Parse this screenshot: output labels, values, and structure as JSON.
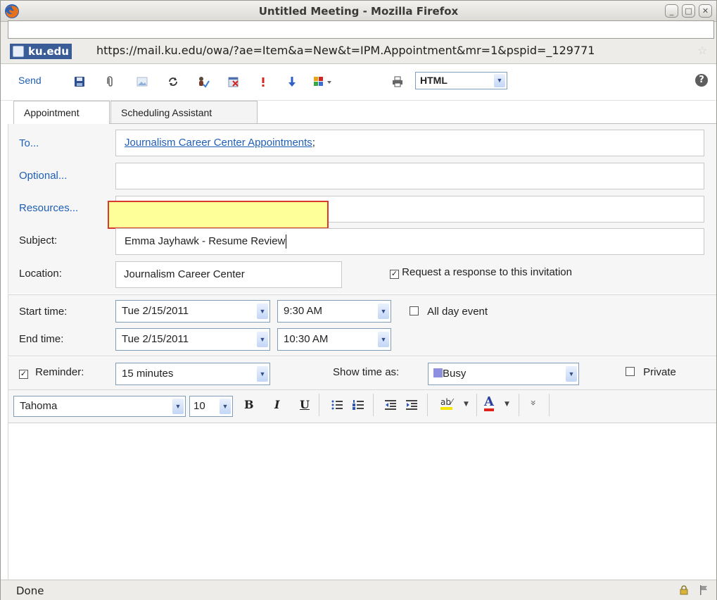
{
  "window": {
    "title": "Untitled Meeting - Mozilla Firefox",
    "controls": {
      "minimize": "_",
      "maximize": "□",
      "close": "✕"
    }
  },
  "urlbar": {
    "site": "ku.edu",
    "url": "https://mail.ku.edu/owa/?ae=Item&a=New&t=IPM.Appointment&mr=1&pspid=_129771"
  },
  "toolbar": {
    "send_label": "Send",
    "format_value": "HTML",
    "help_label": "?",
    "icons": [
      "save-icon",
      "attach-icon",
      "insert-image-icon",
      "recurrence-icon",
      "check-names-icon",
      "cancel-invite-icon",
      "importance-high-icon",
      "importance-low-icon",
      "categories-icon",
      "print-icon"
    ]
  },
  "tabs": [
    {
      "label": "Appointment",
      "active": true
    },
    {
      "label": "Scheduling Assistant",
      "active": false
    }
  ],
  "form": {
    "to_label": "To...",
    "to_value": "Journalism Career Center Appointments",
    "to_suffix": ";",
    "optional_label": "Optional...",
    "resources_label": "Resources...",
    "subject_label": "Subject:",
    "subject_value": "Emma Jayhawk - Resume Review",
    "location_label": "Location:",
    "location_value": "Journalism Career Center",
    "request_response_label": "Request a response to this invitation",
    "request_response_checked": true
  },
  "time": {
    "start_label": "Start time:",
    "start_date": "Tue 2/15/2011",
    "start_time": "9:30 AM",
    "end_label": "End time:",
    "end_date": "Tue 2/15/2011",
    "end_time": "10:30 AM",
    "all_day_label": "All day event",
    "all_day_checked": false
  },
  "reminder": {
    "label": "Reminder:",
    "checked": true,
    "value": "15 minutes",
    "show_time_as_label": "Show time as:",
    "show_time_as_value": "Busy",
    "busy_color": "#8f8fe0",
    "private_label": "Private",
    "private_checked": false
  },
  "editor": {
    "font": "Tahoma",
    "size": "10",
    "bold": "B",
    "italic": "I",
    "underline": "U",
    "highlight_glyph": "ab",
    "font_color_glyph": "A",
    "more_glyph": "»"
  },
  "status": {
    "text": "Done"
  },
  "colors": {
    "link": "#1f5fb5",
    "highlight_fill": "#ffff99",
    "highlight_border": "#d93b2b",
    "site_badge": "#3a5d98"
  }
}
